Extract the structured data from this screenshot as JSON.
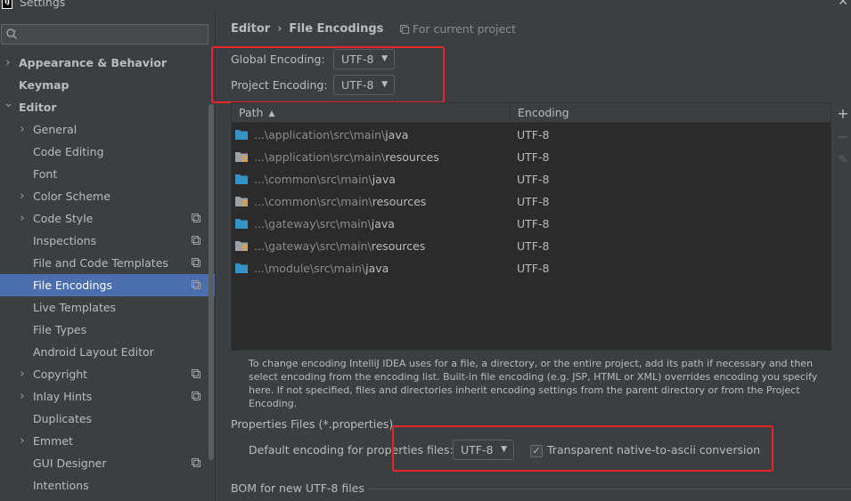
{
  "window": {
    "title": "Settings",
    "close_glyph": "✕"
  },
  "search": {
    "placeholder": "",
    "value": ""
  },
  "sidebar": {
    "items": [
      {
        "label": "Appearance & Behavior",
        "expandable": true,
        "expanded": false,
        "bold": true,
        "level": 0
      },
      {
        "label": "Keymap",
        "expandable": false,
        "bold": true,
        "level": 0
      },
      {
        "label": "Editor",
        "expandable": true,
        "expanded": true,
        "bold": true,
        "level": 0
      },
      {
        "label": "General",
        "expandable": true,
        "expanded": false,
        "level": 1
      },
      {
        "label": "Code Editing",
        "expandable": false,
        "level": 1
      },
      {
        "label": "Font",
        "expandable": false,
        "level": 1
      },
      {
        "label": "Color Scheme",
        "expandable": true,
        "expanded": false,
        "level": 1
      },
      {
        "label": "Code Style",
        "expandable": true,
        "expanded": false,
        "level": 1,
        "project_icon": true
      },
      {
        "label": "Inspections",
        "expandable": false,
        "level": 1,
        "project_icon": true
      },
      {
        "label": "File and Code Templates",
        "expandable": false,
        "level": 1,
        "project_icon": true
      },
      {
        "label": "File Encodings",
        "expandable": false,
        "level": 1,
        "project_icon": true,
        "selected": true
      },
      {
        "label": "Live Templates",
        "expandable": false,
        "level": 1
      },
      {
        "label": "File Types",
        "expandable": false,
        "level": 1
      },
      {
        "label": "Android Layout Editor",
        "expandable": false,
        "level": 1
      },
      {
        "label": "Copyright",
        "expandable": true,
        "expanded": false,
        "level": 1,
        "project_icon": true
      },
      {
        "label": "Inlay Hints",
        "expandable": true,
        "expanded": false,
        "level": 1,
        "project_icon": true
      },
      {
        "label": "Duplicates",
        "expandable": false,
        "level": 1
      },
      {
        "label": "Emmet",
        "expandable": true,
        "expanded": false,
        "level": 1
      },
      {
        "label": "GUI Designer",
        "expandable": false,
        "level": 1,
        "project_icon": true
      },
      {
        "label": "Intentions",
        "expandable": false,
        "level": 1
      }
    ]
  },
  "main": {
    "breadcrumb": {
      "parent": "Editor",
      "separator": "›",
      "current": "File Encodings"
    },
    "scope_note": "For current project",
    "global_encoding": {
      "label": "Global Encoding:",
      "value": "UTF-8"
    },
    "project_encoding": {
      "label": "Project Encoding:",
      "value": "UTF-8"
    },
    "table": {
      "columns": {
        "path": "Path",
        "encoding": "Encoding"
      },
      "rows": [
        {
          "prefix": "...\\application\\src\\main\\",
          "leaf": "java",
          "type": "source",
          "encoding": "UTF-8"
        },
        {
          "prefix": "...\\application\\src\\main\\",
          "leaf": "resources",
          "type": "resources",
          "encoding": "UTF-8"
        },
        {
          "prefix": "...\\common\\src\\main\\",
          "leaf": "java",
          "type": "source",
          "encoding": "UTF-8"
        },
        {
          "prefix": "...\\common\\src\\main\\",
          "leaf": "resources",
          "type": "resources",
          "encoding": "UTF-8"
        },
        {
          "prefix": "...\\gateway\\src\\main\\",
          "leaf": "java",
          "type": "source",
          "encoding": "UTF-8"
        },
        {
          "prefix": "...\\gateway\\src\\main\\",
          "leaf": "resources",
          "type": "resources",
          "encoding": "UTF-8"
        },
        {
          "prefix": "...\\module\\src\\main\\",
          "leaf": "java",
          "type": "source",
          "encoding": "UTF-8"
        }
      ],
      "tools": {
        "add": "+",
        "remove": "−",
        "edit": "✎"
      }
    },
    "note": "To change encoding IntelliJ IDEA uses for a file, a directory, or the entire project, add its path if necessary and then select encoding from the encoding list. Built-in file encoding (e.g. JSP, HTML or XML) overrides encoding you specify here. If not specified, files and directories inherit encoding settings from the parent directory or from the Project Encoding.",
    "properties": {
      "title": "Properties Files (*.properties)",
      "default_label": "Default encoding for properties files:",
      "default_value": "UTF-8",
      "checkbox_label": "Transparent native-to-ascii conversion",
      "checkbox_checked": true
    },
    "bom_title": "BOM for new UTF-8 files"
  },
  "colors": {
    "background": "#3c3f41",
    "table_background": "#2b2b2b",
    "selection": "#4b6eaf",
    "highlight_box": "#e8262a",
    "folder_blue": "#3592c4",
    "text": "#bbbbbb"
  }
}
